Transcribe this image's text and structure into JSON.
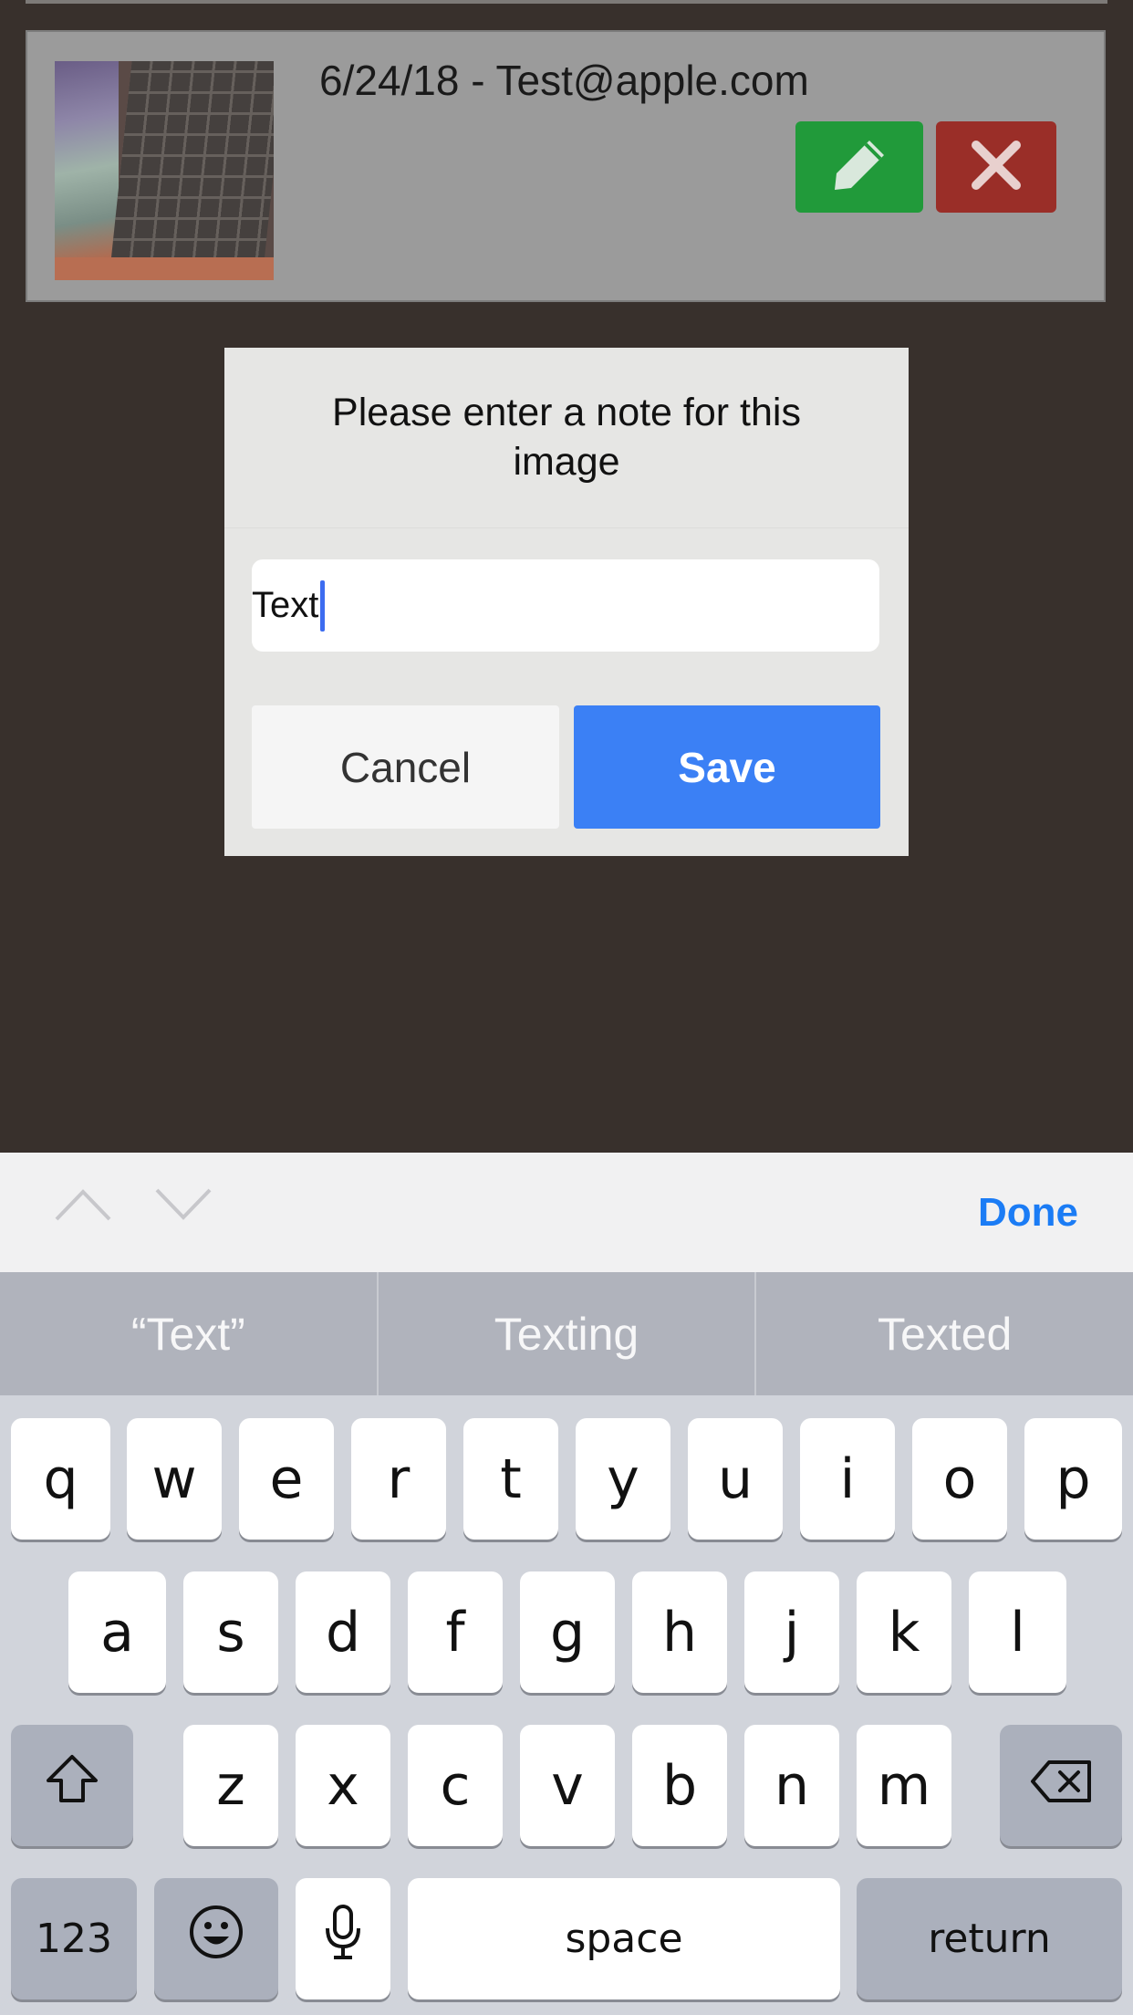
{
  "background_card": {
    "title": "6/24/18 - Test@apple.com",
    "edit_icon": "pencil-icon",
    "delete_icon": "close-icon",
    "edit_color": "#219a3a",
    "delete_color": "#9a2e28"
  },
  "dialog": {
    "title": "Please enter a note for this image",
    "input_value": "Text",
    "cancel_label": "Cancel",
    "save_label": "Save",
    "save_color": "#3b80f5"
  },
  "accessory_bar": {
    "prev_icon": "chevron-up-icon",
    "next_icon": "chevron-down-icon",
    "done_label": "Done"
  },
  "suggestions": [
    "“Text”",
    "Texting",
    "Texted"
  ],
  "keyboard": {
    "row1": [
      "q",
      "w",
      "e",
      "r",
      "t",
      "y",
      "u",
      "i",
      "o",
      "p"
    ],
    "row2": [
      "a",
      "s",
      "d",
      "f",
      "g",
      "h",
      "j",
      "k",
      "l"
    ],
    "row3": [
      "z",
      "x",
      "c",
      "v",
      "b",
      "n",
      "m"
    ],
    "shift_icon": "shift-icon",
    "backspace_icon": "backspace-icon",
    "numbers_label": "123",
    "emoji_icon": "emoji-icon",
    "mic_icon": "microphone-icon",
    "space_label": "space",
    "return_label": "return"
  }
}
